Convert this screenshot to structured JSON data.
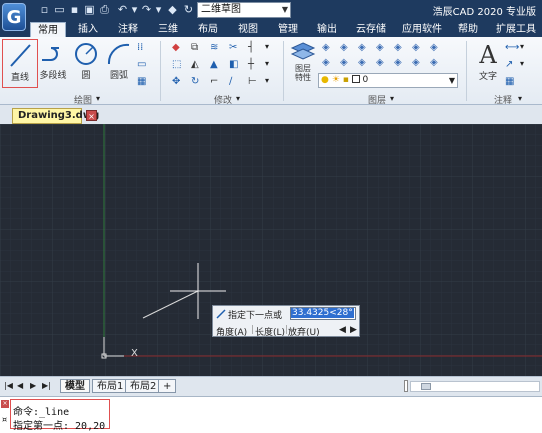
{
  "titlebar": {
    "workspace": "二维草图",
    "app_title": "浩辰CAD 2020 专业版"
  },
  "tabs": [
    "常用",
    "插入",
    "注释",
    "三维",
    "布局",
    "视图",
    "管理",
    "输出",
    "云存储",
    "应用软件",
    "帮助",
    "扩展工具"
  ],
  "ribbon": {
    "tools": {
      "line": "直线",
      "polyline": "多段线",
      "circle": "圆",
      "arc": "圆弧",
      "layer_props": "图层\n特性",
      "text": "文字"
    },
    "groups": {
      "draw": "绘图",
      "modify": "修改",
      "layer": "图层",
      "annotation": "注释"
    },
    "layer_current": "0"
  },
  "document": {
    "tab_label": "Drawing3.dwg",
    "close_symbol": "×"
  },
  "canvas": {
    "ucs_x_label": "X",
    "background": "#252b35"
  },
  "dynamic_input": {
    "prompt": "指定下一点或",
    "value": "33.4325<28°",
    "options": [
      "角度(A)",
      "长度(L)",
      "放弃(U)"
    ]
  },
  "layout_tabs": [
    "模型",
    "布局1",
    "布局2",
    "+"
  ],
  "command": {
    "lines": [
      "命令:_line",
      "指定第一点: 20,20"
    ]
  },
  "colors": {
    "accent": "#1e3a5f",
    "canvas_bg": "#252b35",
    "selection": "#2f6fd0",
    "highlight_border": "#e05050"
  }
}
